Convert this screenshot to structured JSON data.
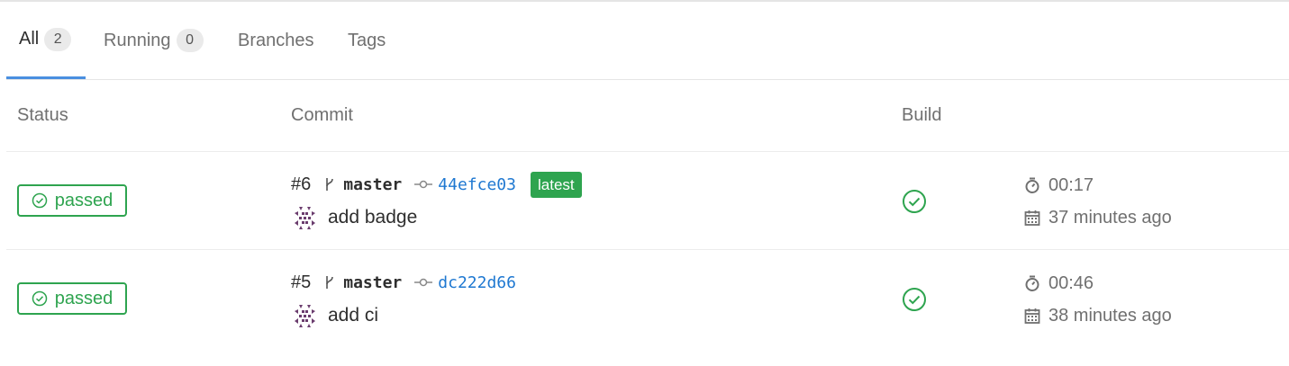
{
  "tabs": [
    {
      "label": "All",
      "count": "2",
      "active": true
    },
    {
      "label": "Running",
      "count": "0",
      "active": false
    },
    {
      "label": "Branches"
    },
    {
      "label": "Tags"
    }
  ],
  "table": {
    "headers": {
      "status": "Status",
      "commit": "Commit",
      "build": "Build"
    }
  },
  "pipelines": [
    {
      "status": "passed",
      "id": "#6",
      "branch": "master",
      "sha": "44efce03",
      "latest_label": "latest",
      "message": "add badge",
      "duration": "00:17",
      "finished": "37 minutes ago"
    },
    {
      "status": "passed",
      "id": "#5",
      "branch": "master",
      "sha": "dc222d66",
      "message": "add ci",
      "duration": "00:46",
      "finished": "38 minutes ago"
    }
  ],
  "colors": {
    "success": "#2ea44f",
    "link": "#1f78d1",
    "active_tab": "#4a8fe0"
  },
  "icons": {
    "status": "check-circle-icon",
    "branch": "branch-icon",
    "commit": "commit-icon",
    "timer": "timer-icon",
    "calendar": "calendar-icon",
    "avatar": "identicon-avatar"
  }
}
